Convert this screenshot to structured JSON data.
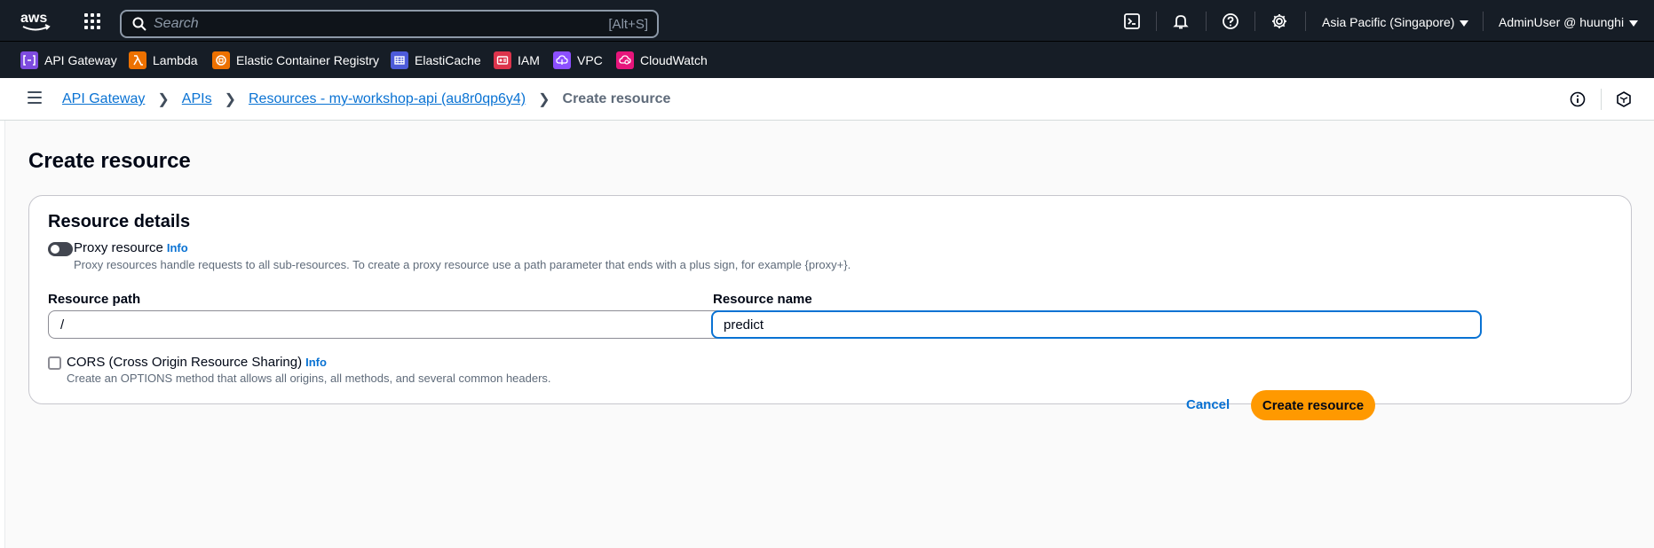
{
  "topnav": {
    "logo_text": "aws",
    "search_placeholder": "Search",
    "search_shortcut": "[Alt+S]",
    "icons": [
      "cloudshell-icon",
      "bell-icon",
      "help-icon",
      "gear-icon"
    ],
    "region": "Asia Pacific (Singapore)",
    "user": "AdminUser @ huunghi"
  },
  "favorites": [
    {
      "label": "API Gateway",
      "color": "#7d4bdf"
    },
    {
      "label": "Lambda",
      "color": "#ed7100"
    },
    {
      "label": "Elastic Container Registry",
      "color": "#ed7100"
    },
    {
      "label": "ElastiCache",
      "color": "#4d5bd9"
    },
    {
      "label": "IAM",
      "color": "#dd344c"
    },
    {
      "label": "VPC",
      "color": "#8c4fff"
    },
    {
      "label": "CloudWatch",
      "color": "#e7157b"
    }
  ],
  "breadcrumb": {
    "items": [
      "API Gateway",
      "APIs",
      "Resources - my-workshop-api (au8r0qp6y4)"
    ],
    "current": "Create resource"
  },
  "page": {
    "title": "Create resource",
    "panel_title": "Resource details",
    "proxy": {
      "label": "Proxy resource",
      "info": "Info",
      "description": "Proxy resources handle requests to all sub-resources. To create a proxy resource use a path parameter that ends with a plus sign, for example {proxy+}."
    },
    "resource_path": {
      "label": "Resource path",
      "value": "/"
    },
    "resource_name": {
      "label": "Resource name",
      "value": "predict"
    },
    "cors": {
      "label": "CORS (Cross Origin Resource Sharing)",
      "info": "Info",
      "description": "Create an OPTIONS method that allows all origins, all methods, and several common headers."
    },
    "cancel_label": "Cancel",
    "create_label": "Create resource"
  },
  "colors": {
    "nav_bg": "#161d26",
    "link": "#0972d3",
    "primary_button": "#ff9900"
  }
}
